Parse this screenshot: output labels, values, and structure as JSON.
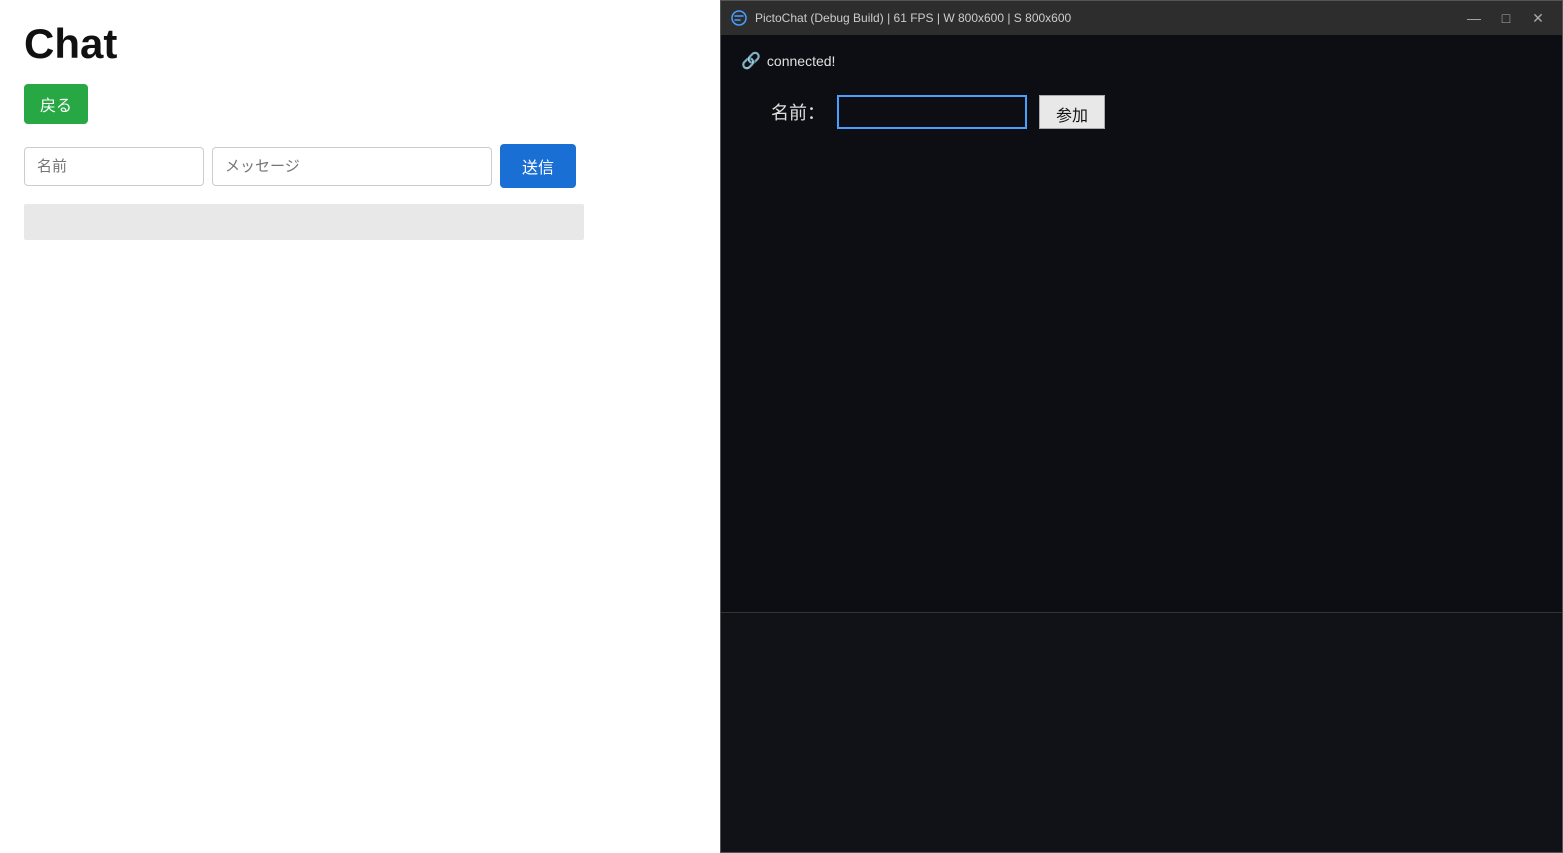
{
  "left": {
    "title": "Chat",
    "back_button": "戻る",
    "name_placeholder": "名前",
    "message_placeholder": "メッセージ",
    "send_button": "送信"
  },
  "right": {
    "window_title": "PictoChat (Debug Build) | 61 FPS | W 800x600 | S 800x600",
    "connected_status": "connected!",
    "name_label": "名前：",
    "join_button": "参加",
    "minimize": "—",
    "maximize": "□",
    "close": "✕"
  }
}
